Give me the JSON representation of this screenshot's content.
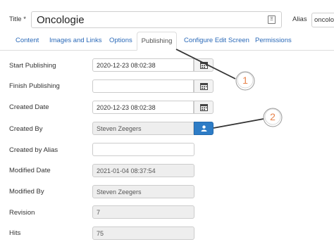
{
  "header": {
    "title_label": "Title *",
    "title_value": "Oncologie",
    "alias_label": "Alias",
    "alias_value": "oncologie"
  },
  "tabs": [
    {
      "label": "Content"
    },
    {
      "label": "Images and Links"
    },
    {
      "label": "Options"
    },
    {
      "label": "Publishing",
      "active": true
    },
    {
      "label": "Configure Edit Screen"
    },
    {
      "label": "Permissions"
    }
  ],
  "fields": {
    "start_publishing": {
      "label": "Start Publishing",
      "value": "2020-12-23 08:02:38"
    },
    "finish_publishing": {
      "label": "Finish Publishing",
      "value": ""
    },
    "created_date": {
      "label": "Created Date",
      "value": "2020-12-23 08:02:38"
    },
    "created_by": {
      "label": "Created By",
      "value": "Steven Zeegers"
    },
    "created_by_alias": {
      "label": "Created by Alias",
      "value": ""
    },
    "modified_date": {
      "label": "Modified Date",
      "value": "2021-01-04 08:37:54"
    },
    "modified_by": {
      "label": "Modified By",
      "value": "Steven Zeegers"
    },
    "revision": {
      "label": "Revision",
      "value": "7"
    },
    "hits": {
      "label": "Hits",
      "value": "75"
    }
  },
  "callouts": [
    {
      "number": "1"
    },
    {
      "number": "2"
    }
  ],
  "colors": {
    "link": "#2a69b8",
    "user_button": "#2d7cc6",
    "callout_number": "#e8824a"
  },
  "icons": {
    "calendar": "calendar-icon",
    "user": "user-icon",
    "title_toggle": "toggle-icon"
  }
}
